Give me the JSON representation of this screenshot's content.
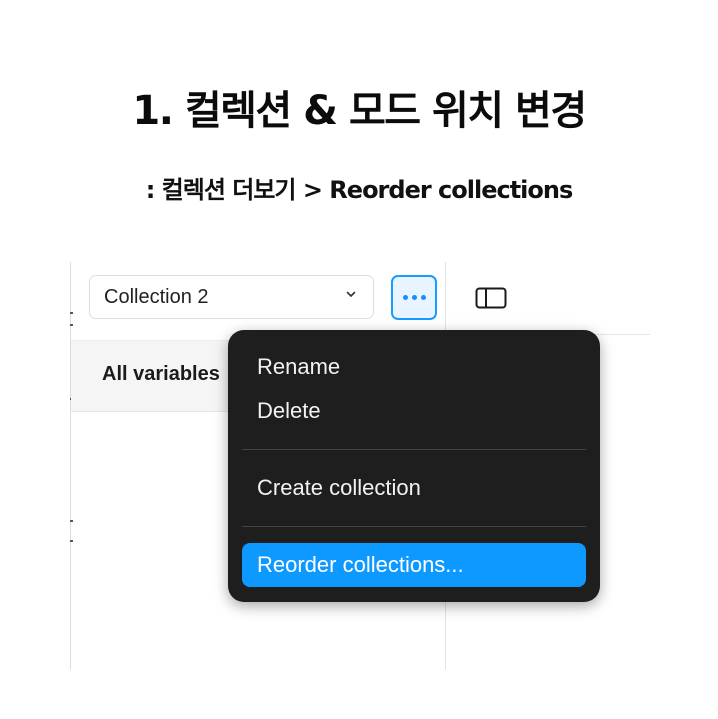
{
  "heading": {
    "title": "1.  컬렉션 & 모드 위치 변경",
    "subtitle": ": 컬렉션 더보기 > Reorder collections"
  },
  "toolbar": {
    "collection_select_value": "Collection 2",
    "more_button_icon": "more-dots-icon",
    "sidebar_toggle_icon": "sidebar-panel-icon"
  },
  "sidebar": {
    "all_variables_label": "All variables"
  },
  "context_menu": {
    "items": [
      {
        "label": "Rename"
      },
      {
        "label": "Delete"
      },
      {
        "label": "Create collection"
      },
      {
        "label": "Reorder collections..."
      }
    ],
    "highlighted_item": "Reorder collections...",
    "colors": {
      "background": "#1e1e1e",
      "highlight": "#0d99ff"
    }
  },
  "colors": {
    "accent": "#1a9cff"
  }
}
